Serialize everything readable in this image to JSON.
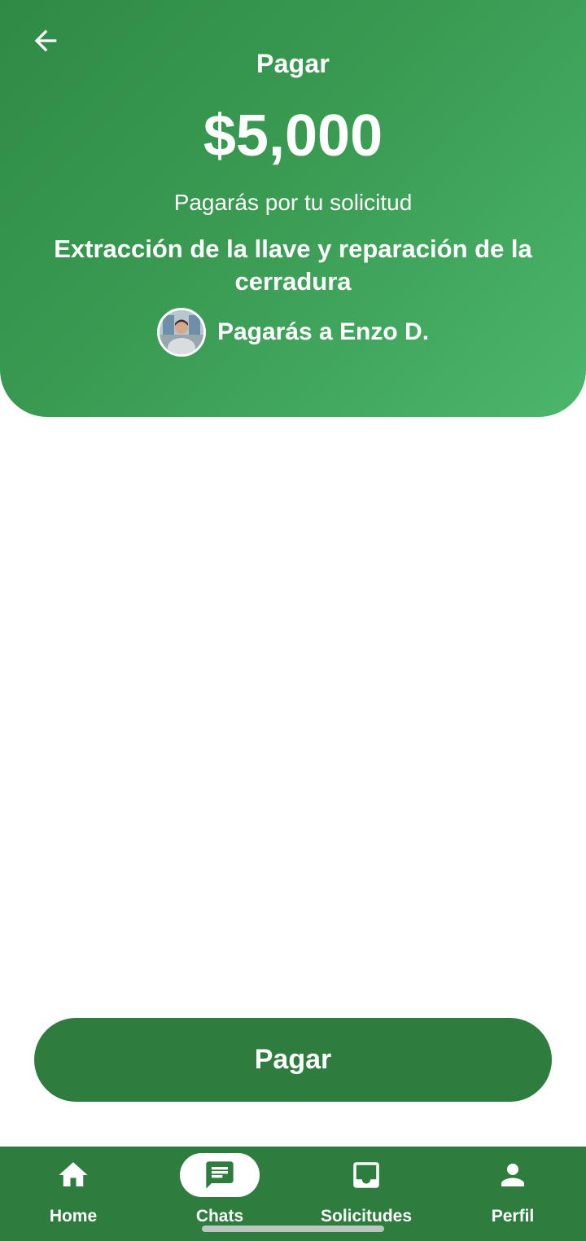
{
  "header": {
    "title": "Pagar",
    "amount": "$5,000",
    "subtitle": "Pagarás por tu solicitud",
    "request_title": "Extracción de la llave y reparación de la cerradura",
    "payee_text": "Pagarás a Enzo D."
  },
  "actions": {
    "pay_label": "Pagar"
  },
  "bottom_nav": {
    "items": [
      {
        "label": "Home",
        "icon": "home-icon",
        "active": false
      },
      {
        "label": "Chats",
        "icon": "chat-icon",
        "active": true
      },
      {
        "label": "Solicitudes",
        "icon": "inbox-icon",
        "active": false
      },
      {
        "label": "Perfil",
        "icon": "person-icon",
        "active": false
      }
    ]
  },
  "colors": {
    "header_gradient_start": "#2e8b45",
    "header_gradient_end": "#4bb66c",
    "primary_dark_green": "#2e7d3e",
    "white": "#ffffff"
  }
}
